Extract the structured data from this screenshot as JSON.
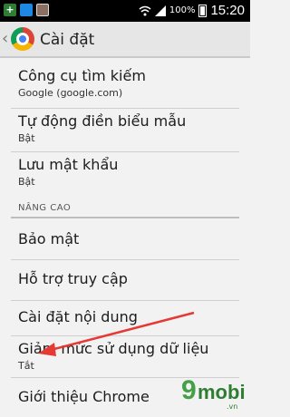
{
  "status_bar": {
    "battery": "100%",
    "time": "15:20"
  },
  "action_bar": {
    "title": "Cài đặt"
  },
  "settings": {
    "items": [
      {
        "label": "Công cụ tìm kiếm",
        "sub": "Google (google.com)"
      },
      {
        "label": "Tự động điền biểu mẫu",
        "sub": "Bật"
      },
      {
        "label": "Lưu mật khẩu",
        "sub": "Bật"
      }
    ],
    "section": "NÂNG CAO",
    "advanced": [
      {
        "label": "Bảo mật"
      },
      {
        "label": "Hỗ trợ truy cập"
      },
      {
        "label": "Cài đặt nội dung"
      },
      {
        "label": "Giảm mức sử dụng dữ liệu",
        "sub": "Tắt"
      },
      {
        "label": "Giới thiệu Chrome"
      }
    ]
  },
  "watermark": {
    "text": "9mobi",
    "domain": ".vn"
  },
  "colors": {
    "arrow": "#e53935",
    "watermark": "#2e7d32"
  }
}
